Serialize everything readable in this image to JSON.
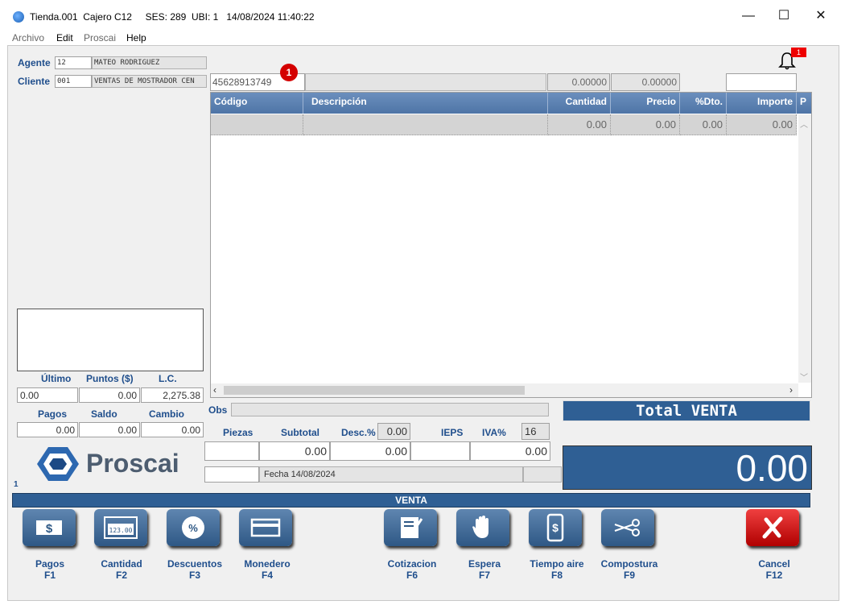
{
  "window": {
    "title": "Tienda.001  Cajero C12     SES: 289  UBI: 1   14/08/2024 11:40:22",
    "minimize": "—",
    "maximize": "☐",
    "close": "✕"
  },
  "menu": [
    "Archivo",
    "Edit",
    "Proscai",
    "Help"
  ],
  "agent": {
    "label": "Agente",
    "code": "12",
    "name": "MATEO RODRIGUEZ"
  },
  "client": {
    "label": "Cliente",
    "code": "001",
    "name": "VENTAS DE MOSTRADOR CEN"
  },
  "entry": {
    "code_value": "45628913749",
    "badge": "1",
    "qty": "0.00000",
    "price": "0.00000",
    "notif_count": "1"
  },
  "grid": {
    "columns": [
      "Código",
      "Descripción",
      "Cantidad",
      "Precio",
      "%Dto.",
      "Importe",
      "P"
    ],
    "row": [
      "",
      "",
      "0.00",
      "0.00",
      "0.00",
      "0.00"
    ]
  },
  "stats": {
    "ultimo_label": "Último",
    "puntos_label": "Puntos ($)",
    "lc_label": "L.C.",
    "ultimo": "0.00",
    "puntos": "0.00",
    "lc": "2,275.38",
    "pagos_label": "Pagos",
    "saldo_label": "Saldo",
    "cambio_label": "Cambio",
    "pagos": "0.00",
    "saldo": "0.00",
    "cambio": "0.00"
  },
  "brand": "Proscai",
  "counter": "1",
  "obs_label": "Obs",
  "totals": {
    "piezas_label": "Piezas",
    "subtotal_label": "Subtotal",
    "desc_label": "Desc.%",
    "desc_value": "0.00",
    "ieps_label": "IEPS",
    "iva_label": "IVA%",
    "iva_value": "16",
    "subtotal": "0.00",
    "desc_amount": "0.00",
    "iva_amount": "0.00",
    "fecha": "Fecha 14/08/2024"
  },
  "total": {
    "title": "Total VENTA",
    "amount": "0.00"
  },
  "mode_bar": "VENTA",
  "buttons": [
    {
      "label": "Pagos",
      "key": "F1",
      "icon": "cash-icon"
    },
    {
      "label": "Cantidad",
      "key": "F2",
      "icon": "quantity-icon"
    },
    {
      "label": "Descuentos",
      "key": "F3",
      "icon": "discount-icon"
    },
    {
      "label": "Monedero",
      "key": "F4",
      "icon": "wallet-card-icon"
    },
    {
      "label": "Cotizacion",
      "key": "F6",
      "icon": "quote-icon"
    },
    {
      "label": "Espera",
      "key": "F7",
      "icon": "hand-icon"
    },
    {
      "label": "Tiempo aire",
      "key": "F8",
      "icon": "phone-credit-icon"
    },
    {
      "label": "Compostura",
      "key": "F9",
      "icon": "scissors-icon"
    },
    {
      "label": "Cancel",
      "key": "F12",
      "icon": "cancel-x-icon"
    }
  ],
  "colors": {
    "accent": "#2f5f94",
    "header": "#5a7fb0",
    "cancel": "#d01515"
  }
}
